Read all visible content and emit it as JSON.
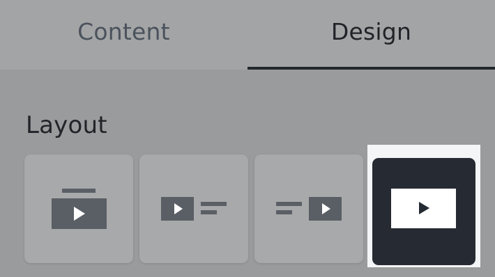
{
  "tabs": [
    {
      "label": "Content",
      "active": false
    },
    {
      "label": "Design",
      "active": true
    }
  ],
  "section": {
    "title": "Layout"
  },
  "layout_options": [
    {
      "icon": "media-top-icon",
      "selected": false
    },
    {
      "icon": "media-left-icon",
      "selected": false
    },
    {
      "icon": "media-right-icon",
      "selected": false
    },
    {
      "icon": "media-full-icon",
      "selected": true
    }
  ],
  "colors": {
    "background": "#9a9b9c",
    "tab_bar": "#a3a4a5",
    "active_tab_text": "#202328",
    "inactive_tab_text": "#4a525c",
    "option_bg": "#a8a9aa",
    "selected_bg": "#262a33",
    "icon_fill": "#5a5f66"
  }
}
